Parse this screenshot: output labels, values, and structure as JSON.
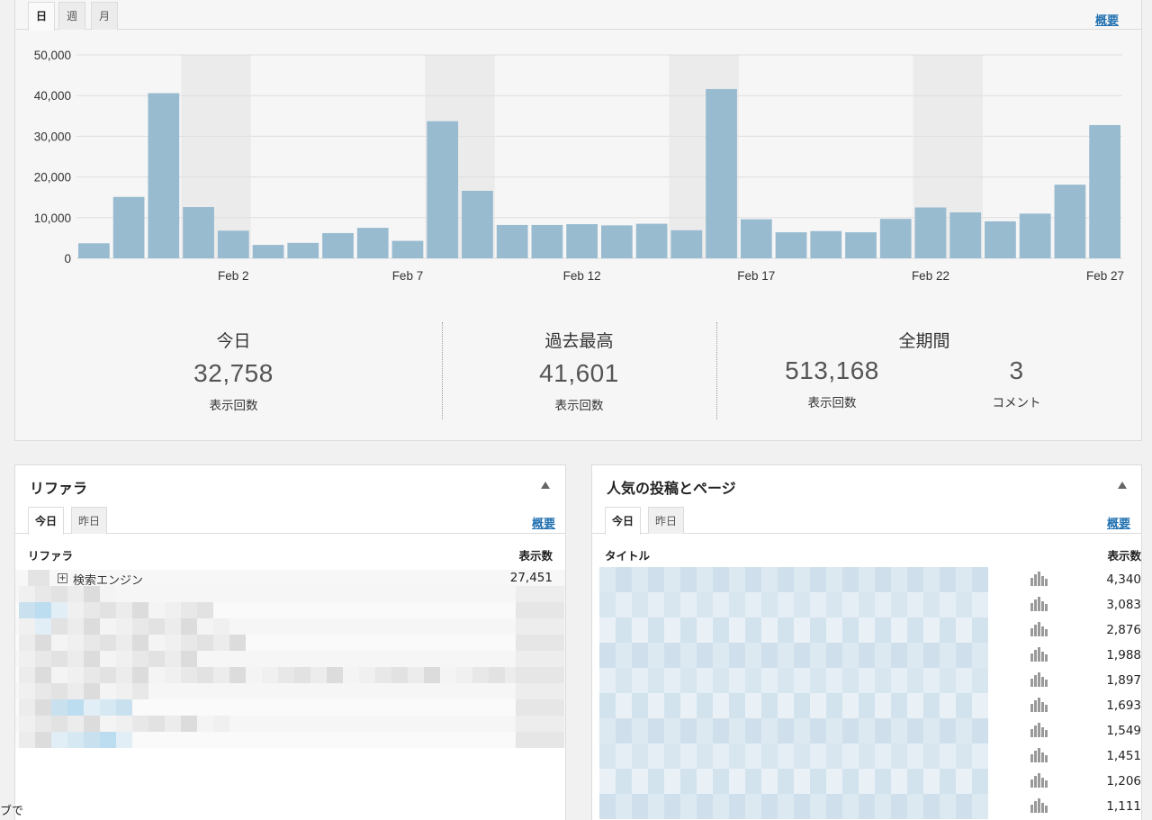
{
  "period_tabs": [
    {
      "label": "日",
      "active": true
    },
    {
      "label": "週",
      "active": false
    },
    {
      "label": "月",
      "active": false
    }
  ],
  "summary_link": "概要",
  "chart_data": {
    "type": "bar",
    "categories": [
      "Jan 29",
      "Jan 30",
      "Jan 31",
      "Feb 1",
      "Feb 2",
      "Feb 3",
      "Feb 4",
      "Feb 5",
      "Feb 6",
      "Feb 7",
      "Feb 8",
      "Feb 9",
      "Feb 10",
      "Feb 11",
      "Feb 12",
      "Feb 13",
      "Feb 14",
      "Feb 15",
      "Feb 16",
      "Feb 17",
      "Feb 18",
      "Feb 19",
      "Feb 20",
      "Feb 21",
      "Feb 22",
      "Feb 23",
      "Feb 24",
      "Feb 25",
      "Feb 26",
      "Feb 27"
    ],
    "x_tick_labels": [
      "Feb 2",
      "Feb 7",
      "Feb 12",
      "Feb 17",
      "Feb 22",
      "Feb 27"
    ],
    "values": [
      3700,
      15100,
      40600,
      12600,
      6800,
      3300,
      3800,
      6200,
      7500,
      4300,
      33700,
      16600,
      8200,
      8200,
      8400,
      8100,
      8500,
      6900,
      41601,
      9600,
      6400,
      6700,
      6400,
      9700,
      12500,
      11300,
      9100,
      11000,
      18100,
      32758
    ],
    "y_tick_labels": [
      "50,000",
      "40,000",
      "30,000",
      "20,000",
      "10,000",
      "0"
    ],
    "ylim": [
      0,
      50000
    ],
    "bar_color": "#98bbd0",
    "weekend_shade_color": "#ebebeb",
    "weekend_shaded_categories": [
      "Feb 1",
      "Feb 2",
      "Feb 8",
      "Feb 9",
      "Feb 15",
      "Feb 16",
      "Feb 22",
      "Feb 23"
    ],
    "grid": true
  },
  "summary": {
    "today": {
      "title": "今日",
      "value": "32,758",
      "unit": "表示回数"
    },
    "best": {
      "title": "過去最高",
      "value": "41,601",
      "unit": "表示回数"
    },
    "all_time": {
      "title": "全期間",
      "views": "513,168",
      "views_unit": "表示回数",
      "comments": "3",
      "comments_unit": "コメント"
    }
  },
  "referrers": {
    "title": "リファラ",
    "tabs": [
      {
        "label": "今日",
        "active": true
      },
      {
        "label": "昨日",
        "active": false
      }
    ],
    "link": "概要",
    "col_name": "リファラ",
    "col_views": "表示数",
    "rows": [
      {
        "label": "検索エンジン",
        "views": "27,451"
      }
    ]
  },
  "top_posts": {
    "title": "人気の投稿とページ",
    "tabs": [
      {
        "label": "今日",
        "active": true
      },
      {
        "label": "昨日",
        "active": false
      }
    ],
    "link": "概要",
    "col_title": "タイトル",
    "col_views": "表示数",
    "views": [
      "4,340",
      "3,083",
      "2,876",
      "1,988",
      "1,897",
      "1,693",
      "1,549",
      "1,451",
      "1,206",
      "1,111"
    ]
  },
  "edge_text": "ブで",
  "colors": {
    "accent_link": "#2271b1",
    "bar": "#98bbd0"
  }
}
